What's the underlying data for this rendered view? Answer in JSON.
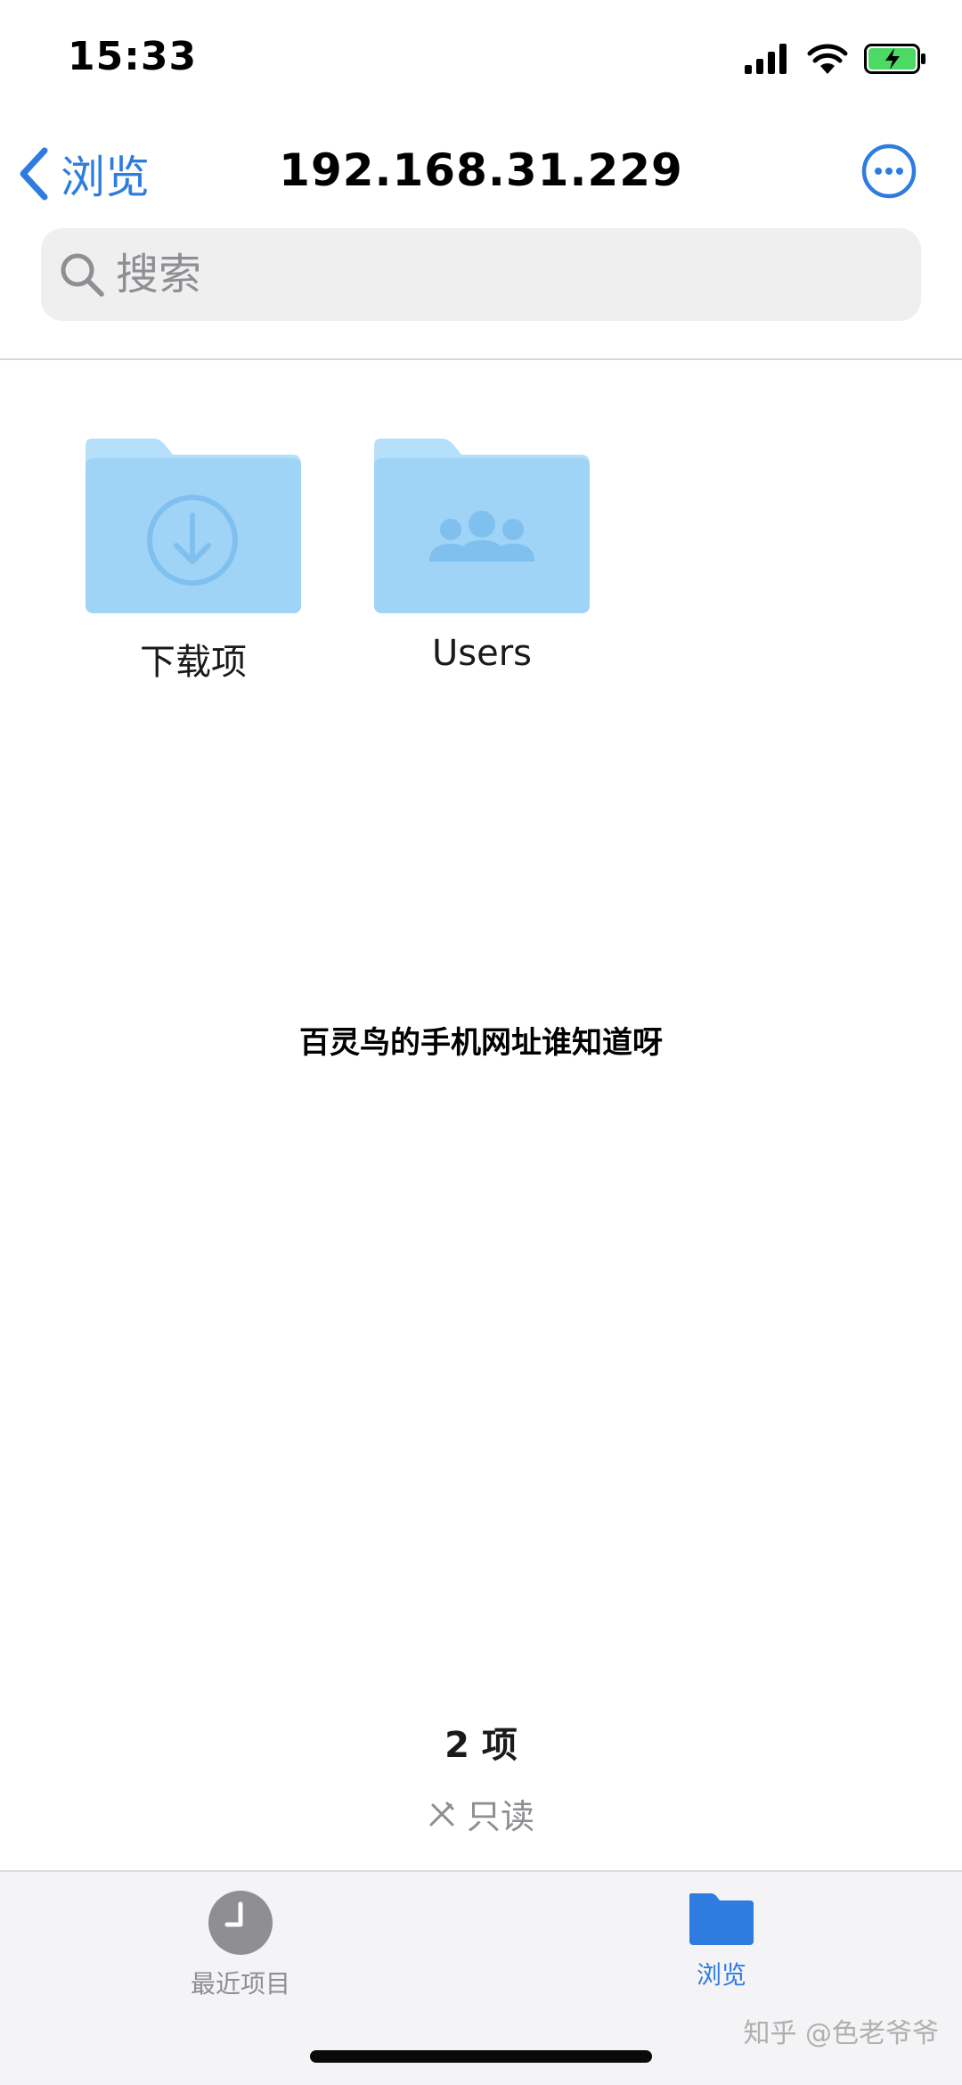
{
  "status_bar": {
    "time": "15:33",
    "icons": [
      "signal-icon",
      "wifi-icon",
      "battery-charging-icon"
    ]
  },
  "nav": {
    "back_label": "浏览",
    "title": "192.168.31.229",
    "more_icon": "ellipsis-circle-icon"
  },
  "search": {
    "placeholder": "搜索"
  },
  "files": [
    {
      "name": "下载项",
      "icon": "folder-download-icon"
    },
    {
      "name": "Users",
      "icon": "folder-users-icon"
    }
  ],
  "caption": "百灵鸟的手机网址谁知道呀",
  "footer": {
    "item_count": "2 项",
    "readonly_label": "只读"
  },
  "tabs": [
    {
      "label": "最近项目",
      "icon": "clock-icon",
      "active": false
    },
    {
      "label": "浏览",
      "icon": "folder-icon",
      "active": true
    }
  ],
  "watermark": "知乎 @色老爷爷",
  "colors": {
    "accent": "#2f7ce0",
    "folder": "#9fd4f7",
    "folder_dark": "#7fc0ee",
    "secondary_text": "#8e8e93"
  }
}
